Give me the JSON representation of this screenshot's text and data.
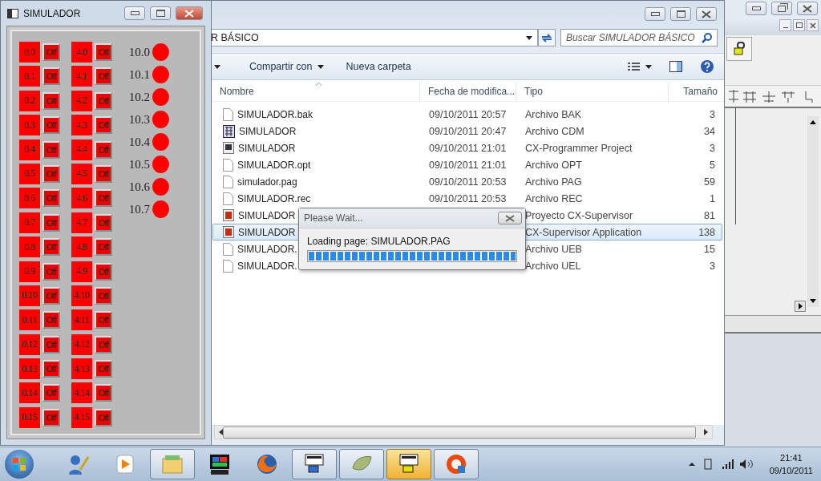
{
  "simulator": {
    "title": "SIMULADOR",
    "input_columns": [
      [
        {
          "label": "0.0",
          "button": "Off",
          "on": false
        },
        {
          "label": "0.1",
          "button": "Off",
          "on": false
        },
        {
          "label": "0.2",
          "button": "Off",
          "on": false
        },
        {
          "label": "0.3",
          "button": "Off",
          "on": false
        },
        {
          "label": "0.4",
          "button": "Off",
          "on": false
        },
        {
          "label": "0.5",
          "button": "Off",
          "on": false
        },
        {
          "label": "0.6",
          "button": "Off",
          "on": false
        },
        {
          "label": "0.7",
          "button": "Off",
          "on": false
        },
        {
          "label": "0.8",
          "button": "Off",
          "on": false
        },
        {
          "label": "0.9",
          "button": "Off",
          "on": false
        },
        {
          "label": "0.10",
          "button": "Off",
          "on": false
        },
        {
          "label": "0.11",
          "button": "Off",
          "on": false
        },
        {
          "label": "0.12",
          "button": "Off",
          "on": false
        },
        {
          "label": "0.13",
          "button": "Off",
          "on": false
        },
        {
          "label": "0.14",
          "button": "Off",
          "on": false
        },
        {
          "label": "0.15",
          "button": "Off",
          "on": false
        }
      ],
      [
        {
          "label": "4.0",
          "button": "Off",
          "on": false
        },
        {
          "label": "4.1",
          "button": "Off",
          "on": false
        },
        {
          "label": "4.2",
          "button": "Off",
          "on": false
        },
        {
          "label": "4.3",
          "button": "Off",
          "on": false
        },
        {
          "label": "4.4",
          "button": "Off",
          "on": false
        },
        {
          "label": "4.5",
          "button": "Off",
          "on": false
        },
        {
          "label": "4.6",
          "button": "Off",
          "on": false
        },
        {
          "label": "4.7",
          "button": "Off",
          "on": false
        },
        {
          "label": "4.8",
          "button": "Off",
          "on": false
        },
        {
          "label": "4.9",
          "button": "Off",
          "on": false
        },
        {
          "label": "4.10",
          "button": "Off",
          "on": false
        },
        {
          "label": "4.11",
          "button": "Off",
          "on": false
        },
        {
          "label": "4.12",
          "button": "Off",
          "on": false
        },
        {
          "label": "4.13",
          "button": "Off",
          "on": false
        },
        {
          "label": "4.14",
          "button": "Off",
          "on": false
        },
        {
          "label": "4.15",
          "button": "Off",
          "on": false
        }
      ]
    ],
    "outputs": [
      {
        "label": "10.0",
        "on": false
      },
      {
        "label": "10.1",
        "on": false
      },
      {
        "label": "10.2",
        "on": false
      },
      {
        "label": "10.3",
        "on": false
      },
      {
        "label": "10.4",
        "on": false
      },
      {
        "label": "10.5",
        "on": false
      },
      {
        "label": "10.6",
        "on": false
      },
      {
        "label": "10.7",
        "on": false
      }
    ]
  },
  "explorer": {
    "address": "R BÁSICO",
    "search": {
      "placeholder": "Buscar SIMULADOR BÁSICO"
    },
    "toolbar": [
      {
        "label": "Compartir con",
        "menu": true
      },
      {
        "label": "Nueva carpeta",
        "menu": false
      }
    ],
    "columns": [
      "Nombre",
      "Fecha de modifica...",
      "Tipo",
      "Tamaño"
    ],
    "files": [
      {
        "kind": "document",
        "name": "SIMULADOR.bak",
        "date": "09/10/2011 20:57",
        "type": "Archivo BAK",
        "size": "3",
        "selected": false
      },
      {
        "kind": "cdm",
        "name": "SIMULADOR",
        "date": "09/10/2011 20:47",
        "type": "Archivo CDM",
        "size": "34",
        "selected": false
      },
      {
        "kind": "project",
        "name": "SIMULADOR",
        "date": "09/10/2011 21:01",
        "type": "CX-Programmer Project",
        "size": "3",
        "selected": false
      },
      {
        "kind": "document",
        "name": "SIMULADOR.opt",
        "date": "09/10/2011 21:01",
        "type": "Archivo OPT",
        "size": "5",
        "selected": false
      },
      {
        "kind": "document",
        "name": "simulador.pag",
        "date": "09/10/2011 20:53",
        "type": "Archivo PAG",
        "size": "59",
        "selected": false
      },
      {
        "kind": "document",
        "name": "SIMULADOR.rec",
        "date": "09/10/2011 20:53",
        "type": "Archivo REC",
        "size": "1",
        "selected": false
      },
      {
        "kind": "supervisor",
        "name": "SIMULADOR",
        "type": "Proyecto CX-Supervisor",
        "size": "81",
        "selected": false
      },
      {
        "kind": "supervisor",
        "name": "SIMULADOR",
        "type": "CX-Supervisor Application",
        "size": "138",
        "selected": true
      },
      {
        "kind": "document",
        "name": "SIMULADOR.",
        "type": "Archivo UEB",
        "size": "15",
        "selected": false
      },
      {
        "kind": "document",
        "name": "SIMULADOR.",
        "type": "Archivo UEL",
        "size": "3",
        "selected": false
      }
    ]
  },
  "dialog": {
    "title": "Please Wait...",
    "message": "Loading page: SIMULADOR.PAG",
    "level": 1
  },
  "taskbar": {
    "items": [
      {
        "running": false,
        "active": false
      },
      {
        "running": false,
        "active": false
      },
      {
        "running": true,
        "active": false
      },
      {
        "running": false,
        "active": false
      },
      {
        "running": false,
        "active": false
      },
      {
        "running": true,
        "active": false
      },
      {
        "running": true,
        "active": false
      },
      {
        "running": true,
        "active": true
      },
      {
        "running": true,
        "active": false
      }
    ],
    "time": "21:41",
    "date": "09/10/2011"
  }
}
